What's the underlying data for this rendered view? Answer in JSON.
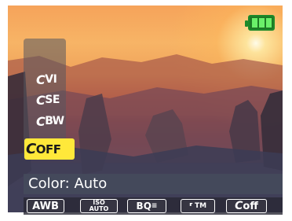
{
  "battery": {
    "icon": "battery-full-icon",
    "color": "#6af06a"
  },
  "color_menu": {
    "items": [
      {
        "glyph": "C",
        "label": "VI"
      },
      {
        "glyph": "C",
        "label": "SE"
      },
      {
        "glyph": "C",
        "label": "BW"
      },
      {
        "glyph": "C",
        "label": "OFF"
      }
    ],
    "selected_index": 3,
    "highlight_color": "#ffe83a"
  },
  "status": {
    "text": "Color: Auto"
  },
  "function_bar": {
    "awb": "AWB",
    "iso_top": "ISO",
    "iso_bottom": "AUTO",
    "quality": "BQ",
    "timer": "TM",
    "color_glyph": "C",
    "color_label": "off"
  }
}
